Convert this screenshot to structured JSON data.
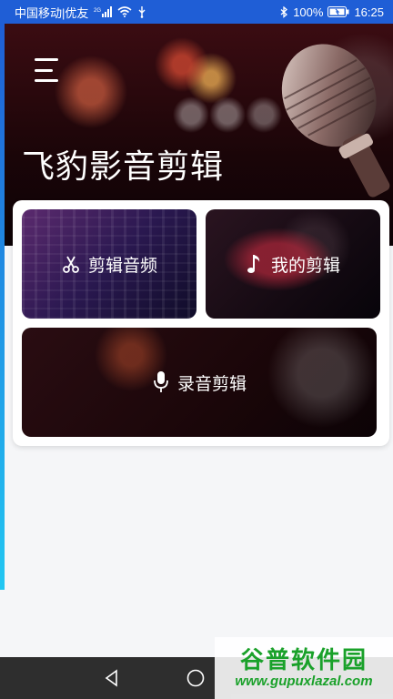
{
  "status_bar": {
    "carrier": "中国移动|优友",
    "network": "2G",
    "battery": "100%",
    "time": "16:25"
  },
  "header": {
    "menu_icon": "menu-icon",
    "title": "飞豹影音剪辑"
  },
  "tiles": [
    {
      "label": "剪辑音频",
      "icon": "scissors-icon"
    },
    {
      "label": "我的剪辑",
      "icon": "music-note-icon"
    },
    {
      "label": "录音剪辑",
      "icon": "microphone-icon"
    }
  ],
  "nav_bar": {
    "back_icon": "back-triangle-icon",
    "home_icon": "home-circle-icon"
  },
  "watermark": {
    "text": "谷普软件园",
    "url": "www.gupuxlazal.com"
  },
  "colors": {
    "status_bar": "#1f5ed6",
    "accent": "#22c7f2",
    "watermark": "#1aa12a",
    "nav_bar": "#2e2e2e"
  }
}
